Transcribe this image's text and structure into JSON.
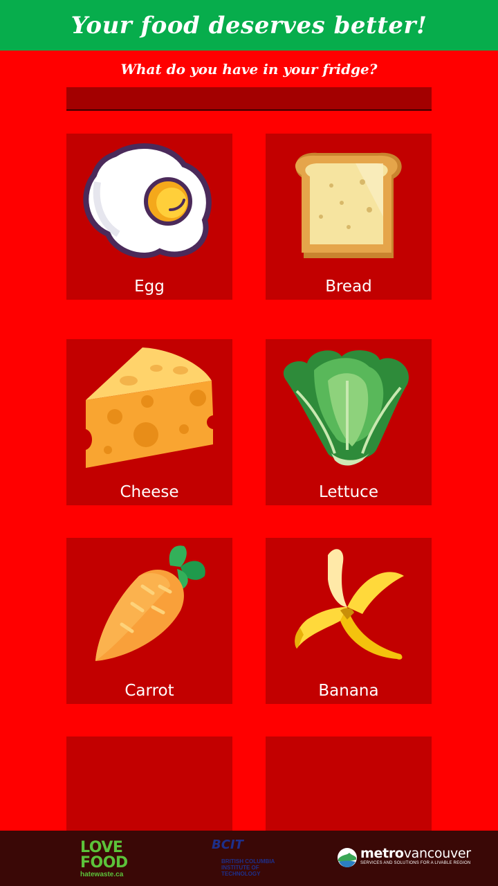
{
  "header": {
    "title": "Your food deserves better!"
  },
  "prompt": "What do you have in your fridge?",
  "search": {
    "value": "",
    "placeholder": ""
  },
  "foods": [
    {
      "label": "Egg",
      "icon": "egg-icon"
    },
    {
      "label": "Bread",
      "icon": "bread-icon"
    },
    {
      "label": "Cheese",
      "icon": "cheese-icon"
    },
    {
      "label": "Lettuce",
      "icon": "lettuce-icon"
    },
    {
      "label": "Carrot",
      "icon": "carrot-icon"
    },
    {
      "label": "Banana",
      "icon": "banana-icon"
    }
  ],
  "footer": {
    "love_food_line1": "LOVE",
    "love_food_line2": "FOOD",
    "love_food_url": "hatewaste.ca",
    "bcit_mark": "BCIT",
    "bcit_line1": "BRITISH COLUMBIA",
    "bcit_line2": "INSTITUTE OF TECHNOLOGY",
    "metro_bold": "metro",
    "metro_rest": "vancouver",
    "metro_tagline": "SERVICES AND SOLUTIONS FOR A LIVABLE REGION"
  },
  "colors": {
    "background": "#ff0000",
    "header": "#07ad4c",
    "tile": "#c20000",
    "search_field": "#a30000",
    "footer": "#3a0806"
  }
}
